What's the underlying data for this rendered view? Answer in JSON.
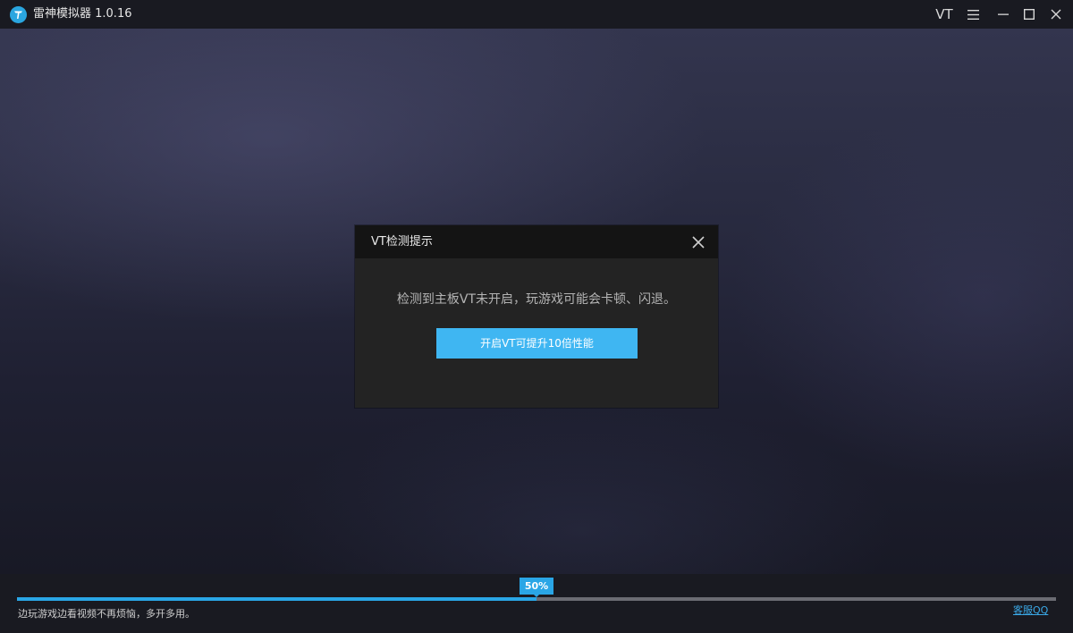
{
  "app": {
    "title": "雷神模拟器 1.0.16",
    "accent_color": "#2aa6e6",
    "logo_icon": "thunder-logo-icon"
  },
  "titlebar": {
    "vt_label": "VT",
    "menu_icon": "hamburger-menu-icon",
    "minimize_icon": "minimize-icon",
    "maximize_icon": "maximize-icon",
    "close_icon": "close-icon"
  },
  "dialog": {
    "title": "VT检测提示",
    "message": "检测到主板VT未开启，玩游戏可能会卡顿、闪退。",
    "button_label": "开启VT可提升10倍性能",
    "button_color": "#3fb6f2",
    "close_icon": "close-icon"
  },
  "bottom": {
    "progress_percent": 50,
    "progress_label": "50%",
    "tip": "边玩游戏边看视频不再烦恼，多开多用。",
    "support_link": "客服QQ"
  }
}
